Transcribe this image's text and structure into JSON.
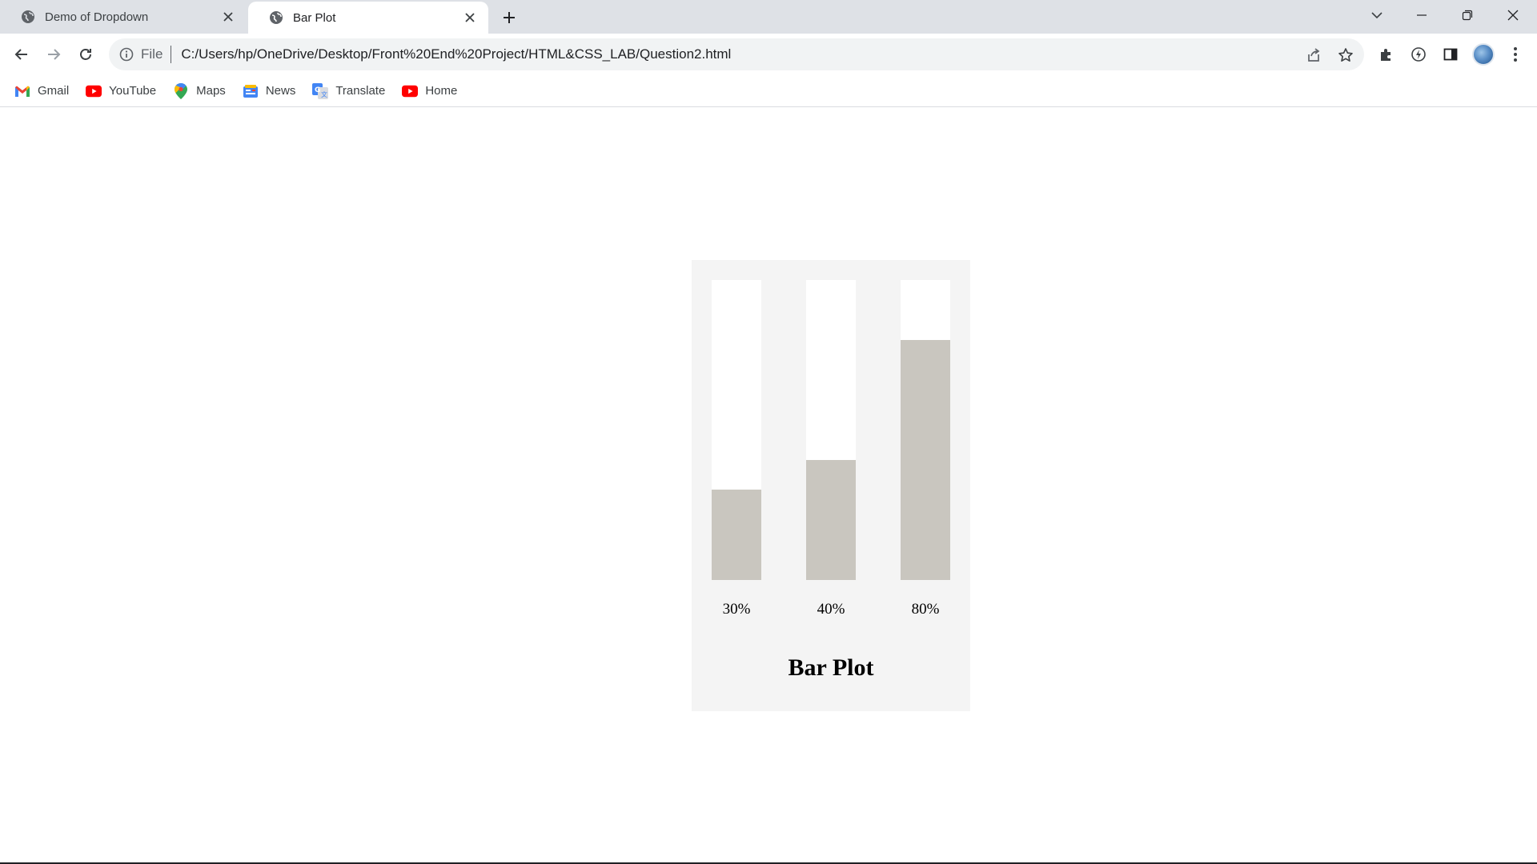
{
  "browser": {
    "tabs": [
      {
        "title": "Demo of Dropdown",
        "active": false,
        "icon": "globe-icon"
      },
      {
        "title": "Bar Plot",
        "active": true,
        "icon": "globe-icon"
      }
    ],
    "address_bar": {
      "scheme_label": "File",
      "url": "C:/Users/hp/OneDrive/Desktop/Front%20End%20Project/HTML&CSS_LAB/Question2.html"
    },
    "bookmarks": [
      {
        "label": "Gmail",
        "icon": "gmail-icon"
      },
      {
        "label": "YouTube",
        "icon": "youtube-icon"
      },
      {
        "label": "Maps",
        "icon": "maps-icon"
      },
      {
        "label": "News",
        "icon": "news-icon"
      },
      {
        "label": "Translate",
        "icon": "translate-icon"
      },
      {
        "label": "Home",
        "icon": "youtube-icon"
      }
    ],
    "colors": {
      "tabstrip": "#dee1e6",
      "omnibox": "#f1f3f4"
    }
  },
  "page": {
    "colors": {
      "panel": "#f4f4f4",
      "bar_track": "#ffffff",
      "bar_fill": "#c9c6bf"
    }
  },
  "chart_data": {
    "type": "bar",
    "title": "Bar Plot",
    "categories": [
      "30%",
      "40%",
      "80%"
    ],
    "values": [
      30,
      40,
      80
    ],
    "ylim": [
      0,
      100
    ],
    "xlabel": "",
    "ylabel": "",
    "grid": false
  }
}
